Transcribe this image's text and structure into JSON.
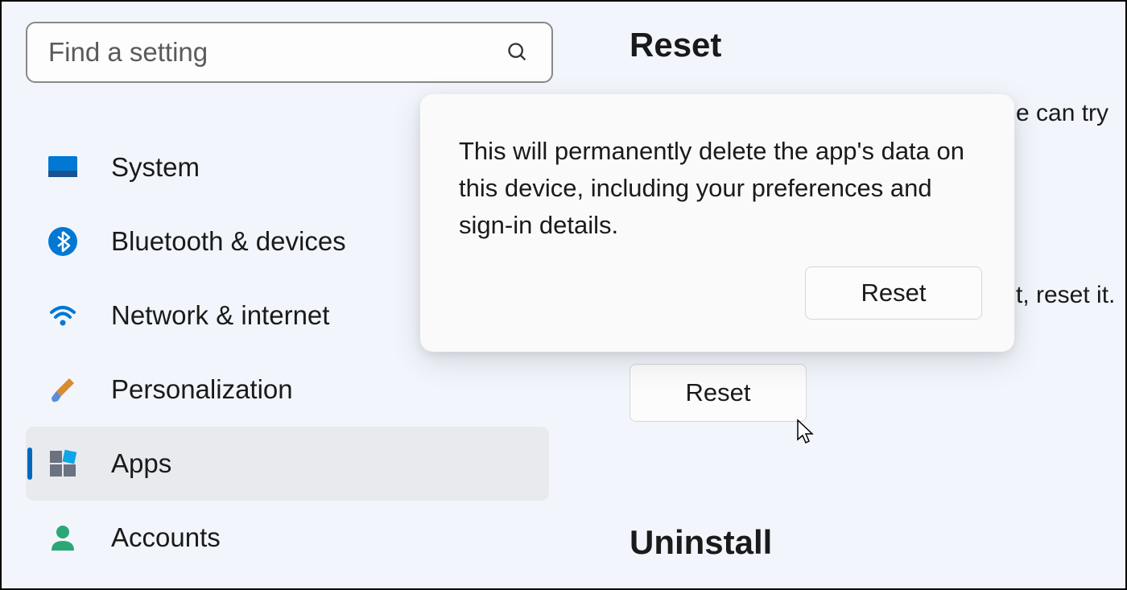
{
  "search": {
    "placeholder": "Find a setting"
  },
  "sidebar": {
    "items": [
      {
        "label": "System"
      },
      {
        "label": "Bluetooth & devices"
      },
      {
        "label": "Network & internet"
      },
      {
        "label": "Personalization"
      },
      {
        "label": "Apps"
      },
      {
        "label": "Accounts"
      }
    ]
  },
  "main": {
    "reset_heading": "Reset",
    "uninstall_heading": "Uninstall",
    "trailing_text_1": "e can try",
    "trailing_text_2": "t, reset it.",
    "reset_button": "Reset"
  },
  "popup": {
    "text": "This will permanently delete the app's data on this device, including your preferences and sign-in details.",
    "confirm_button": "Reset"
  }
}
